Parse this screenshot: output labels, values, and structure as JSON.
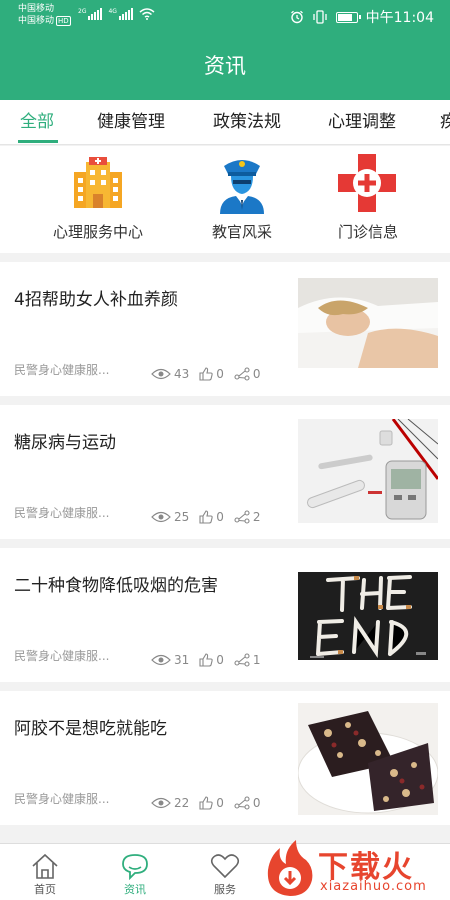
{
  "status_bar": {
    "carrier1": "中国移动",
    "carrier2": "中国移动",
    "hd": "HD",
    "net1": "2G",
    "net2": "4G",
    "time": "中午11:04"
  },
  "header": {
    "title": "资讯"
  },
  "tabs": [
    {
      "label": "全部",
      "active": true
    },
    {
      "label": "健康管理"
    },
    {
      "label": "政策法规"
    },
    {
      "label": "心理调整"
    },
    {
      "label": "疾"
    }
  ],
  "quick_links": [
    {
      "label": "心理服务中心",
      "icon": "building-icon"
    },
    {
      "label": "教官风采",
      "icon": "police-officer-icon"
    },
    {
      "label": "门诊信息",
      "icon": "medical-cross-icon"
    }
  ],
  "articles": [
    {
      "title": "4招帮助女人补血养颜",
      "source": "民警身心健康服...",
      "views": "43",
      "likes": "0",
      "shares": "0",
      "image": "sleeping-woman-photo"
    },
    {
      "title": "糖尿病与运动",
      "source": "民警身心健康服...",
      "views": "25",
      "likes": "0",
      "shares": "2",
      "image": "glucose-meter-photo"
    },
    {
      "title": "二十种食物降低吸烟的危害",
      "source": "民警身心健康服...",
      "views": "31",
      "likes": "0",
      "shares": "1",
      "image": "cigarettes-the-end-photo"
    },
    {
      "title": "阿胶不是想吃就能吃",
      "source": "民警身心健康服...",
      "views": "22",
      "likes": "0",
      "shares": "0",
      "image": "ejiao-cake-photo"
    }
  ],
  "bottom_nav": [
    {
      "label": "首页",
      "icon": "home-icon"
    },
    {
      "label": "资讯",
      "icon": "chat-bubble-icon",
      "active": true
    },
    {
      "label": "服务",
      "icon": "heart-icon"
    }
  ],
  "watermark": {
    "text": "下载火",
    "url": "xiazaihuo.com"
  },
  "colors": {
    "brand": "#2fae7d",
    "watermark": "#e7452e"
  }
}
